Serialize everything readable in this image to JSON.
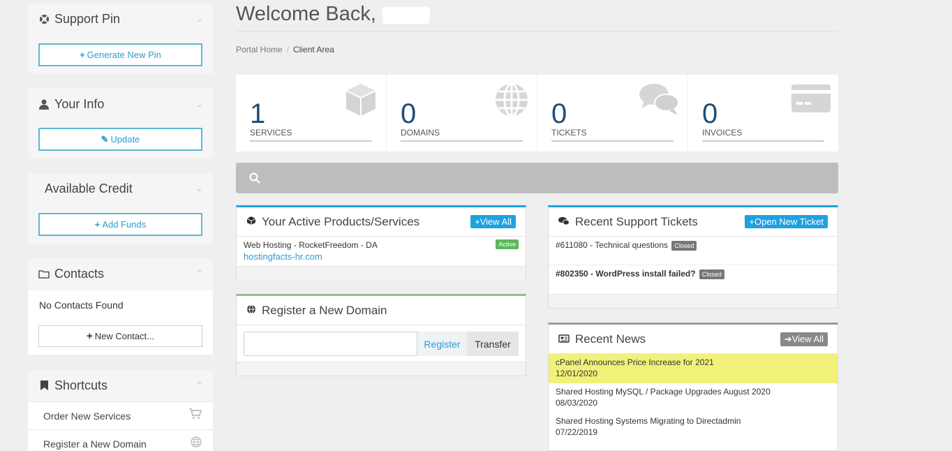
{
  "header": {
    "welcome": "Welcome Back,",
    "breadcrumb": {
      "home": "Portal Home",
      "current": "Client Area"
    }
  },
  "sidebar": {
    "support_pin": {
      "title": "Support Pin",
      "button": "Generate New Pin"
    },
    "your_info": {
      "title": "Your Info",
      "button": "Update"
    },
    "credit": {
      "title": "Available Credit",
      "button": "Add Funds"
    },
    "contacts": {
      "title": "Contacts",
      "empty": "No Contacts Found",
      "button": "New Contact..."
    },
    "shortcuts": {
      "title": "Shortcuts",
      "items": [
        {
          "label": "Order New Services",
          "icon": "cart-icon"
        },
        {
          "label": "Register a New Domain",
          "icon": "globe-icon"
        }
      ]
    }
  },
  "stats": [
    {
      "value": "1",
      "label": "SERVICES",
      "icon": "cube-icon"
    },
    {
      "value": "0",
      "label": "DOMAINS",
      "icon": "globe-icon"
    },
    {
      "value": "0",
      "label": "TICKETS",
      "icon": "comments-icon"
    },
    {
      "value": "0",
      "label": "INVOICES",
      "icon": "credit-card-icon"
    }
  ],
  "products": {
    "title": "Your Active Products/Services",
    "button": "View All",
    "items": [
      {
        "name": "Web Hosting - RocketFreedom - DA",
        "domain": "hostingfacts-hr.com",
        "status": "Active"
      }
    ]
  },
  "domain": {
    "title": "Register a New Domain",
    "input_value": "",
    "register": "Register",
    "transfer": "Transfer"
  },
  "tickets": {
    "title": "Recent Support Tickets",
    "button": "Open New Ticket",
    "items": [
      {
        "label": "#611080 - Technical questions",
        "status": "Closed"
      },
      {
        "label": "#802350 - WordPress install failed?",
        "status": "Closed"
      }
    ]
  },
  "news": {
    "title": "Recent News",
    "button": "View All",
    "items": [
      {
        "title": "cPanel Announces Price Increase for 2021",
        "date": "12/01/2020"
      },
      {
        "title": "Shared Hosting MySQL / Package Upgrades August 2020",
        "date": "08/03/2020"
      },
      {
        "title": "Shared Hosting Systems Migrating to Directadmin",
        "date": "07/22/2019"
      }
    ]
  },
  "colors": {
    "accent": "#1fa1e0",
    "stat_number": "#1d4e7c",
    "news_highlight": "#f1f17a",
    "active_tag": "#5cb85c"
  }
}
